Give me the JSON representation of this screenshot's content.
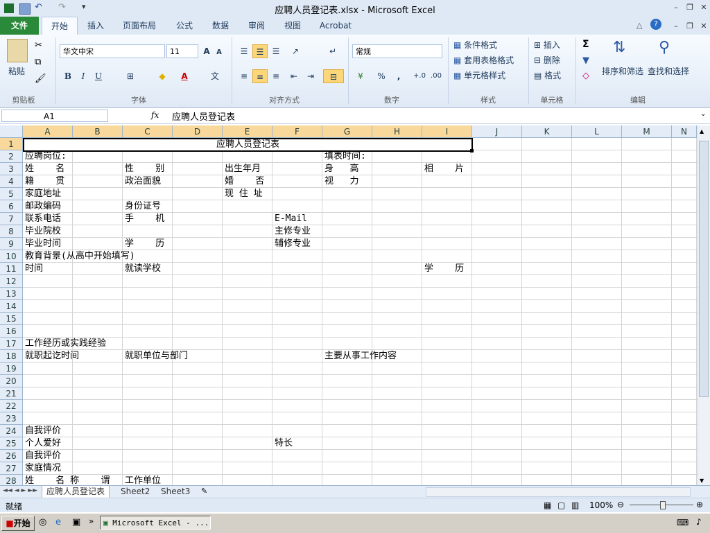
{
  "window": {
    "title": "应聘人员登记表.xlsx  -  Microsoft Excel"
  },
  "tabs": [
    "文件",
    "开始",
    "插入",
    "页面布局",
    "公式",
    "数据",
    "审阅",
    "视图",
    "Acrobat"
  ],
  "ribbon": {
    "clipboard": {
      "paste": "粘贴",
      "label": "剪贴板"
    },
    "font": {
      "name": "华文中宋",
      "size": "11",
      "bold": "B",
      "italic": "I",
      "underline": "U",
      "label": "字体"
    },
    "alignment": {
      "label": "对齐方式"
    },
    "number": {
      "format": "常规",
      "percent": "%",
      "comma": ",",
      "label": "数字"
    },
    "styles": {
      "conditional": "条件格式",
      "table": "套用表格格式",
      "cell": "单元格样式",
      "label": "样式"
    },
    "cells": {
      "insert": "插入",
      "delete": "删除",
      "format": "格式",
      "label": "单元格"
    },
    "editing": {
      "sort": "排序和筛选",
      "find": "查找和选择",
      "label": "编辑"
    }
  },
  "formula_bar": {
    "name_box": "A1",
    "fx": "fx",
    "formula": "应聘人员登记表"
  },
  "columns": [
    "A",
    "B",
    "C",
    "D",
    "E",
    "F",
    "G",
    "H",
    "I",
    "J",
    "K",
    "L",
    "M",
    "N"
  ],
  "rows": [
    "1",
    "2",
    "3",
    "4",
    "5",
    "6",
    "7",
    "8",
    "9",
    "10",
    "11",
    "12",
    "13",
    "14",
    "15",
    "16",
    "17",
    "18",
    "19",
    "20",
    "21",
    "22",
    "23",
    "24",
    "25",
    "26",
    "27",
    "28"
  ],
  "cells": {
    "title": "应聘人员登记表",
    "r2": [
      "应聘岗位:",
      "填表时间:"
    ],
    "r3": [
      "姓    名",
      "性    别",
      "出生年月",
      "身   高",
      "相    片"
    ],
    "r4": [
      "籍    贯",
      "政治面貌",
      "婚    否",
      "视   力"
    ],
    "r5": [
      "家庭地址",
      "现 住 址"
    ],
    "r6": [
      "邮政编码",
      "身份证号"
    ],
    "r7": [
      "联系电话",
      "手    机",
      "E-Mail"
    ],
    "r8": [
      "毕业院校",
      "主修专业"
    ],
    "r9": [
      "毕业时间",
      "学    历",
      "辅修专业"
    ],
    "r10": [
      "教育背景(从高中开始填写)"
    ],
    "r11": [
      "时间",
      "就读学校",
      "学    历"
    ],
    "r17": [
      "工作经历或实践经验"
    ],
    "r18": [
      "就职起讫时间",
      "就职单位与部门",
      "主要从事工作内容"
    ],
    "r24": [
      "自我评价"
    ],
    "r25": [
      "个人爱好",
      "特长"
    ],
    "r26": [
      "自我评价"
    ],
    "r27": [
      "家庭情况"
    ],
    "r28": [
      "姓    名 称    谓",
      "工作单位"
    ]
  },
  "sheets": [
    "应聘人员登记表",
    "Sheet2",
    "Sheet3"
  ],
  "status": {
    "ready": "就绪",
    "zoom": "100%"
  },
  "taskbar": {
    "start": "开始",
    "app": "Microsoft Excel - ..."
  }
}
